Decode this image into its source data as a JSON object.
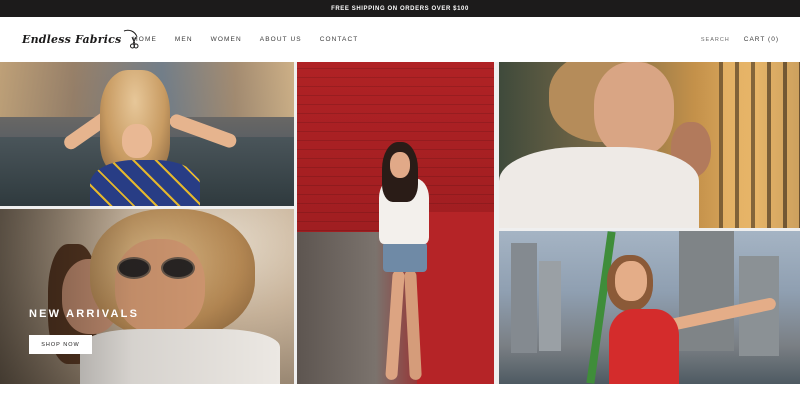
{
  "announcement": "FREE SHIPPING ON ORDERS OVER $100",
  "header": {
    "logo_text": "Endless Fabrics",
    "nav": [
      {
        "label": "HOME"
      },
      {
        "label": "MEN"
      },
      {
        "label": "WOMEN"
      },
      {
        "label": "ABOUT US"
      },
      {
        "label": "CONTACT"
      }
    ],
    "search_label": "SEARCH",
    "cart_label": "CART (0)"
  },
  "hero": {
    "heading": "NEW ARRIVALS",
    "button_label": "SHOP NOW"
  },
  "icons": {
    "logo": "scissors-icon"
  },
  "colors": {
    "announcement_bg": "#1c1b1b",
    "text": "#1c1b1b",
    "accent_red": "#a11e21"
  }
}
